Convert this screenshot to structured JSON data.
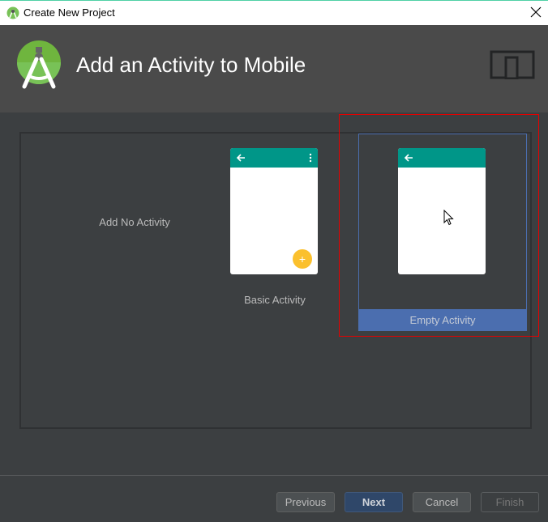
{
  "window": {
    "title": "Create New Project",
    "icon": "android-studio-icon",
    "close_icon": "close-icon"
  },
  "header": {
    "title": "Add an Activity to Mobile",
    "logo": "android-studio-logo",
    "device_icon": "tablet-phone-icon"
  },
  "gallery": {
    "tiles": [
      {
        "label": "Add No Activity",
        "selected": false
      },
      {
        "label": "Basic Activity",
        "selected": false,
        "has_menu": true,
        "has_fab": true,
        "fab_symbol": "+"
      },
      {
        "label": "Empty Activity",
        "selected": true
      }
    ]
  },
  "colors": {
    "toolbar": "#009688",
    "fab": "#fbc02d",
    "selection": "#4b6eaf",
    "highlight_annotation": "#e60000"
  },
  "footer": {
    "previous_label": "Previous",
    "next_label": "Next",
    "cancel_label": "Cancel",
    "finish_label": "Finish"
  }
}
